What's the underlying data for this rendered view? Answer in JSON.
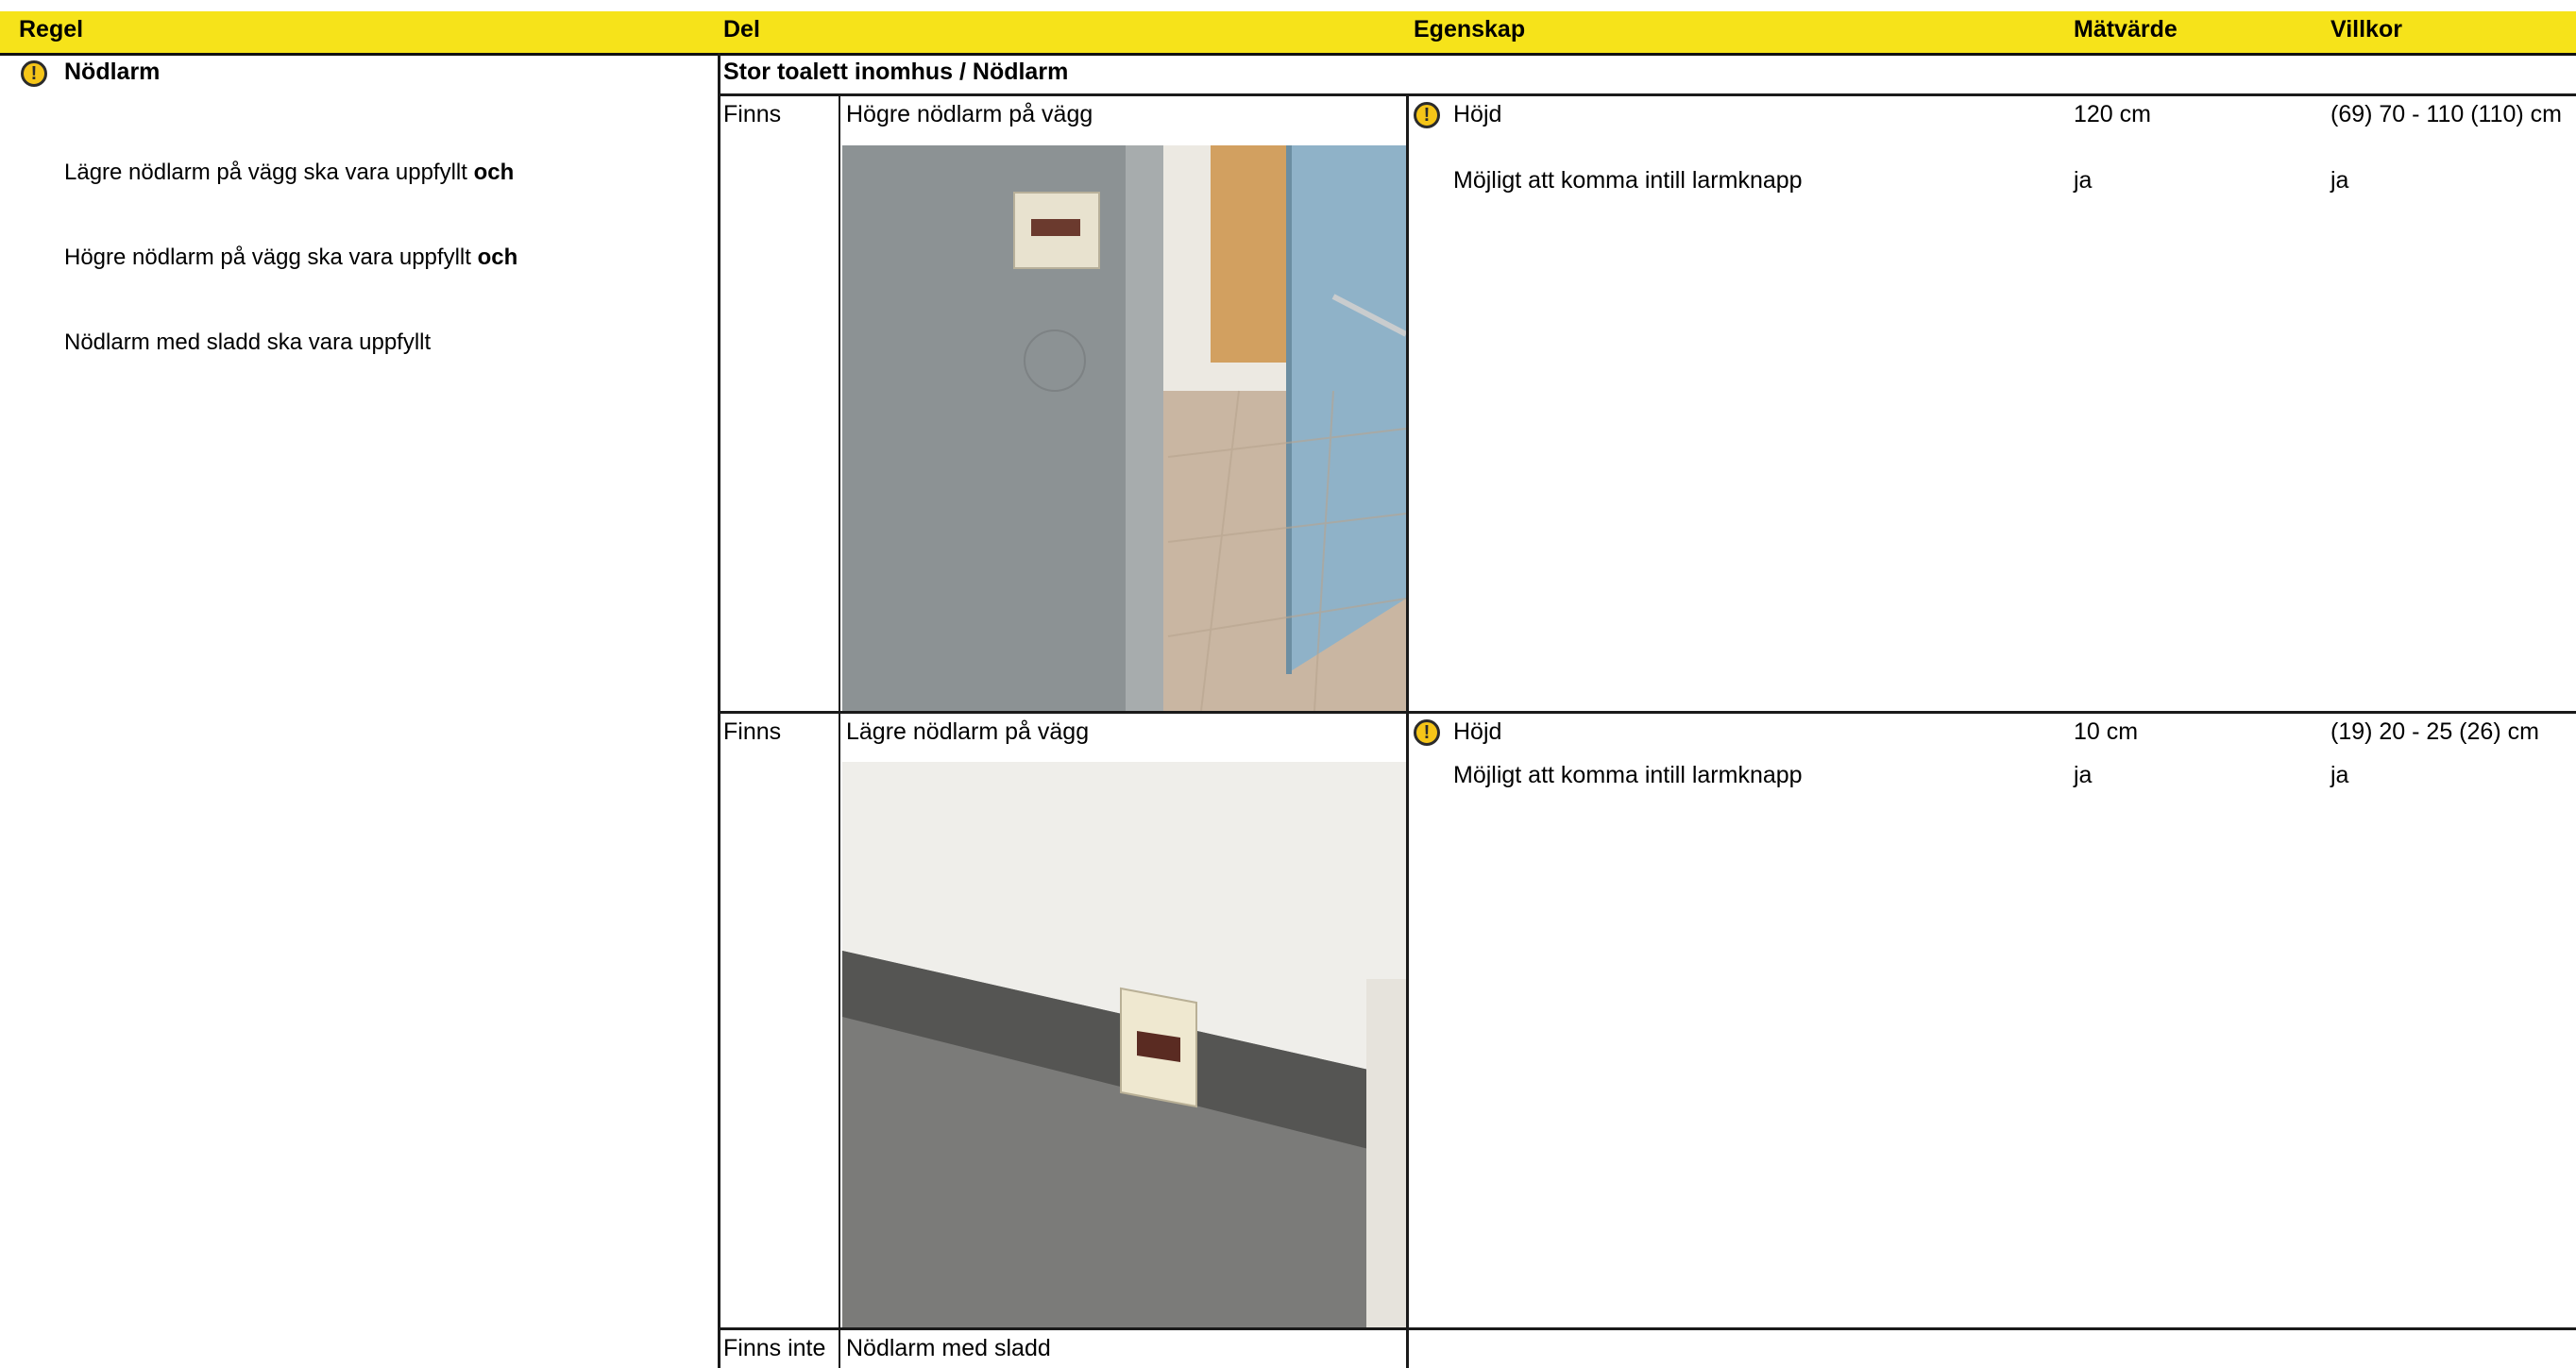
{
  "header": {
    "regel": "Regel",
    "del": "Del",
    "egenskap": "Egenskap",
    "matvarde": "Mätvärde",
    "villkor": "Villkor"
  },
  "rule": {
    "title": "Nödlarm",
    "icon": "warning-icon",
    "lines": [
      {
        "text": "Lägre nödlarm på vägg ska vara uppfyllt ",
        "suffix": "och"
      },
      {
        "text": "Högre nödlarm på vägg ska vara uppfyllt ",
        "suffix": "och"
      },
      {
        "text": "Nödlarm med sladd ska vara uppfyllt",
        "suffix": ""
      }
    ]
  },
  "section": {
    "title": "Stor toalett inomhus / Nödlarm"
  },
  "rows": [
    {
      "status": "Finns",
      "part": "Högre nödlarm på vägg",
      "properties": [
        {
          "name": "Höjd",
          "warning": true,
          "value": "120 cm",
          "condition": "(69) 70 - 110 (110) cm"
        },
        {
          "name": "Möjligt att komma intill larmknapp",
          "warning": false,
          "value": "ja",
          "condition": "ja"
        }
      ]
    },
    {
      "status": "Finns",
      "part": "Lägre nödlarm på vägg",
      "properties": [
        {
          "name": "Höjd",
          "warning": true,
          "value": "10 cm",
          "condition": "(19) 20 - 25 (26) cm"
        },
        {
          "name": "Möjligt att komma intill larmknapp",
          "warning": false,
          "value": "ja",
          "condition": "ja"
        }
      ]
    },
    {
      "status": "Finns inte",
      "part": "Nödlarm med sladd",
      "properties": []
    }
  ],
  "colors": {
    "header_bg": "#f6e31a",
    "warning_icon": "#f5c518",
    "border": "#1a1a1a"
  }
}
